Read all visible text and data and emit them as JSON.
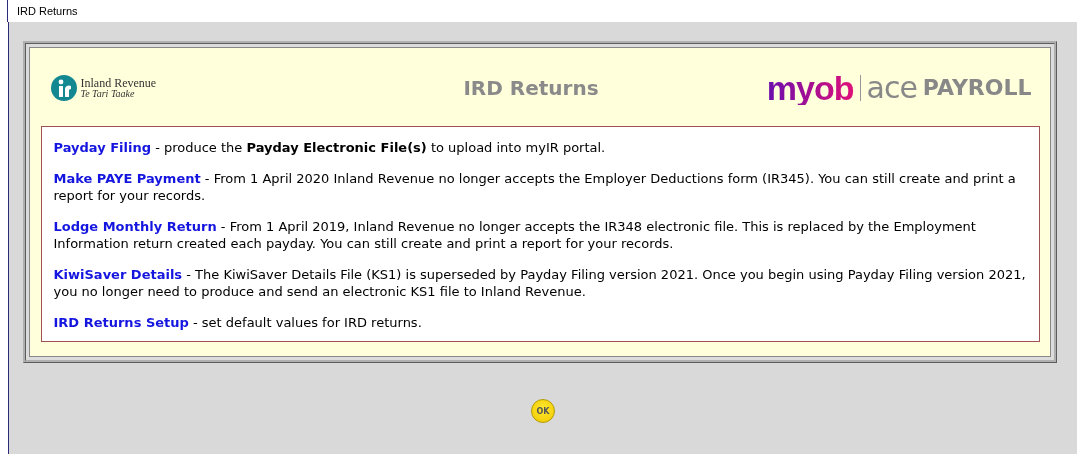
{
  "window": {
    "title": "IRD Returns"
  },
  "header": {
    "ird_logo": {
      "name": "Inland Revenue",
      "subtitle": "Te Tari Taake"
    },
    "title": "IRD Returns",
    "brand_logo": {
      "mark": "myob",
      "product": "ace",
      "suffix": "PAYROLL"
    }
  },
  "items": [
    {
      "link": "Payday Filing",
      "description": " - produce the **Payday Electronic File(s)** to upload into myIR portal."
    },
    {
      "link": "Make PAYE Payment",
      "description": " - From 1 April 2020 Inland Revenue no longer accepts the Employer Deductions form (IR345). You can still create and print a report for your records."
    },
    {
      "link": "Lodge Monthly Return",
      "description": " - From 1 April 2019, Inland Revenue no longer accepts the IR348 electronic file. This is replaced by the Employment Information return created each payday. You can still create and print a report for your records."
    },
    {
      "link": "KiwiSaver Details",
      "description": " - The KiwiSaver Details File (KS1) is superseded by Payday Filing version 2021. Once you begin using Payday Filing version 2021, you no longer need to produce and send an electronic KS1 file to Inland Revenue."
    },
    {
      "link": "IRD Returns Setup",
      "description": " - set default values for IRD returns."
    }
  ],
  "ok_button": "OK"
}
